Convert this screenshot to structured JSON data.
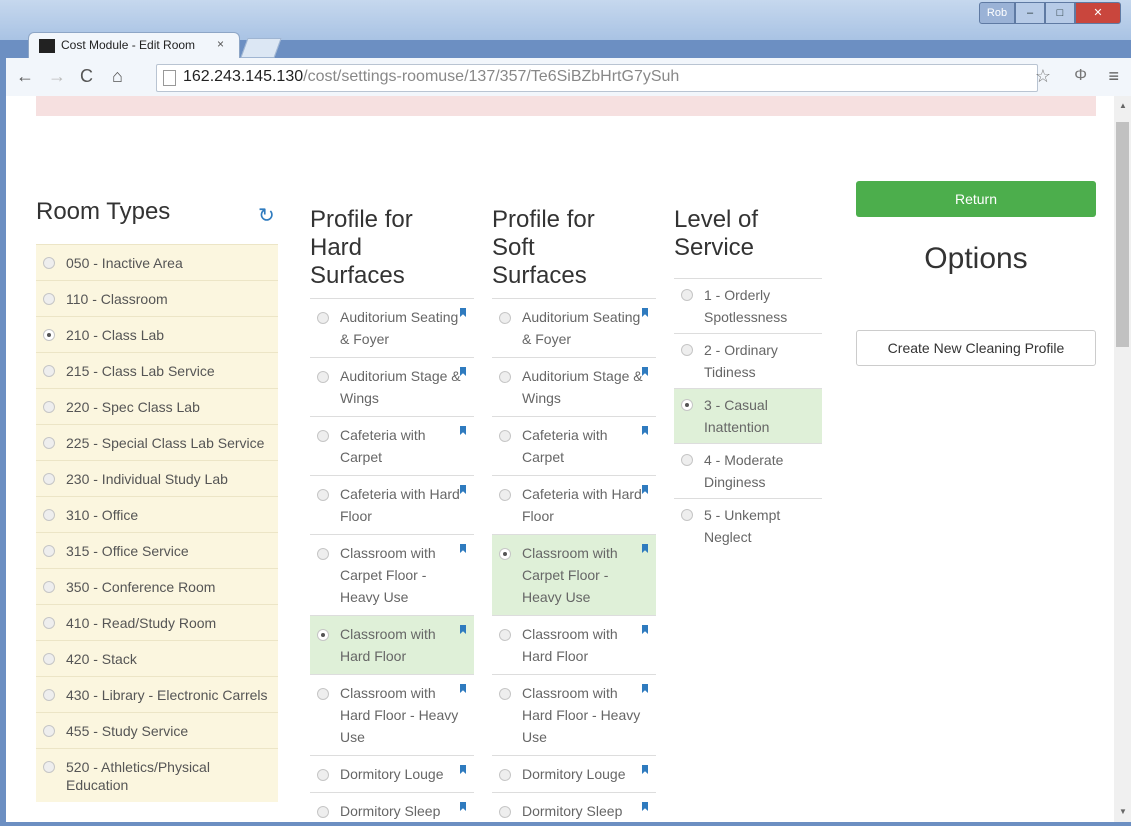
{
  "browser": {
    "tab_title": "Cost Module - Edit Room",
    "tab_close": "×",
    "user_label": "Rob",
    "url_host": "162.243.145.130",
    "url_path": "/cost/settings-roomuse/137/357/Te6SiBZbHrtG7ySuh"
  },
  "room_types": {
    "heading": "Room Types",
    "items": [
      {
        "label": "050 - Inactive Area",
        "selected": false
      },
      {
        "label": "110 - Classroom",
        "selected": false
      },
      {
        "label": "210 - Class Lab",
        "selected": true
      },
      {
        "label": "215 - Class Lab Service",
        "selected": false
      },
      {
        "label": "220 - Spec Class Lab",
        "selected": false
      },
      {
        "label": "225 - Special Class Lab Service",
        "selected": false
      },
      {
        "label": "230 - Individual Study Lab",
        "selected": false
      },
      {
        "label": "310 - Office",
        "selected": false
      },
      {
        "label": "315 - Office Service",
        "selected": false
      },
      {
        "label": "350 - Conference Room",
        "selected": false
      },
      {
        "label": "410 - Read/Study Room",
        "selected": false
      },
      {
        "label": "420 - Stack",
        "selected": false
      },
      {
        "label": "430 - Library - Electronic Carrels",
        "selected": false
      },
      {
        "label": "455 - Study Service",
        "selected": false
      },
      {
        "label": "520 - Athletics/Physical Education",
        "selected": false
      }
    ]
  },
  "hard_surfaces": {
    "heading": "Profile for Hard Surfaces",
    "items": [
      {
        "label": "Auditorium Seating & Foyer",
        "selected": false
      },
      {
        "label": "Auditorium Stage & Wings",
        "selected": false
      },
      {
        "label": "Cafeteria with Carpet",
        "selected": false
      },
      {
        "label": "Cafeteria with Hard Floor",
        "selected": false
      },
      {
        "label": "Classroom with Carpet Floor - Heavy Use",
        "selected": false
      },
      {
        "label": "Classroom with Hard Floor",
        "selected": true
      },
      {
        "label": "Classroom with Hard Floor - Heavy Use",
        "selected": false
      },
      {
        "label": "Dormitory Louge",
        "selected": false
      },
      {
        "label": "Dormitory Sleep Study",
        "selected": false
      }
    ]
  },
  "soft_surfaces": {
    "heading": "Profile for Soft Surfaces",
    "items": [
      {
        "label": "Auditorium Seating & Foyer",
        "selected": false
      },
      {
        "label": "Auditorium Stage & Wings",
        "selected": false
      },
      {
        "label": "Cafeteria with Carpet",
        "selected": false
      },
      {
        "label": "Cafeteria with Hard Floor",
        "selected": false
      },
      {
        "label": "Classroom with Carpet Floor - Heavy Use",
        "selected": true
      },
      {
        "label": "Classroom with Hard Floor",
        "selected": false
      },
      {
        "label": "Classroom with Hard Floor - Heavy Use",
        "selected": false
      },
      {
        "label": "Dormitory Louge",
        "selected": false
      },
      {
        "label": "Dormitory Sleep Study",
        "selected": false
      }
    ]
  },
  "level_of_service": {
    "heading": "Level of Service",
    "items": [
      {
        "label": "1 - Orderly Spotlessness",
        "selected": false
      },
      {
        "label": "2 - Ordinary Tidiness",
        "selected": false
      },
      {
        "label": "3 - Casual Inattention",
        "selected": true
      },
      {
        "label": "4 - Moderate Dinginess",
        "selected": false
      },
      {
        "label": "5 - Unkempt Neglect",
        "selected": false
      }
    ]
  },
  "options": {
    "return_label": "Return",
    "title": "Options",
    "create_label": "Create New Cleaning Profile"
  },
  "colors": {
    "selected_bg": "#dff0d8",
    "room_types_bg": "#fbf6df",
    "return_green": "#4cae4c",
    "accent_blue": "#2f7bbf"
  }
}
